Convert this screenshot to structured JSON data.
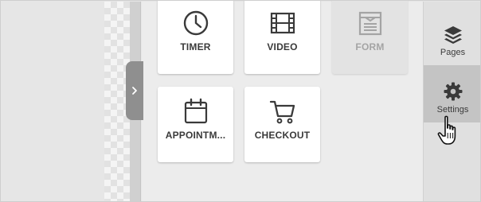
{
  "widgets": [
    {
      "label": "TIMER",
      "icon": "clock-icon",
      "disabled": false
    },
    {
      "label": "VIDEO",
      "icon": "film-icon",
      "disabled": false
    },
    {
      "label": "FORM",
      "icon": "form-icon",
      "disabled": true
    },
    {
      "label": "APPOINTM...",
      "icon": "calendar-icon",
      "disabled": false
    },
    {
      "label": "CHECKOUT",
      "icon": "cart-icon",
      "disabled": false
    }
  ],
  "sidebar": {
    "items": [
      {
        "label": "Pages",
        "icon": "layers-icon",
        "active": false
      },
      {
        "label": "Settings",
        "icon": "gear-icon",
        "active": true
      }
    ]
  },
  "colors": {
    "icon_dark": "#3a3a3a",
    "icon_disabled": "#a4a4a4",
    "panel_bg": "#ececec",
    "sidebar_active": "#c4c4c4"
  },
  "cursor": "hand-pointer-icon"
}
